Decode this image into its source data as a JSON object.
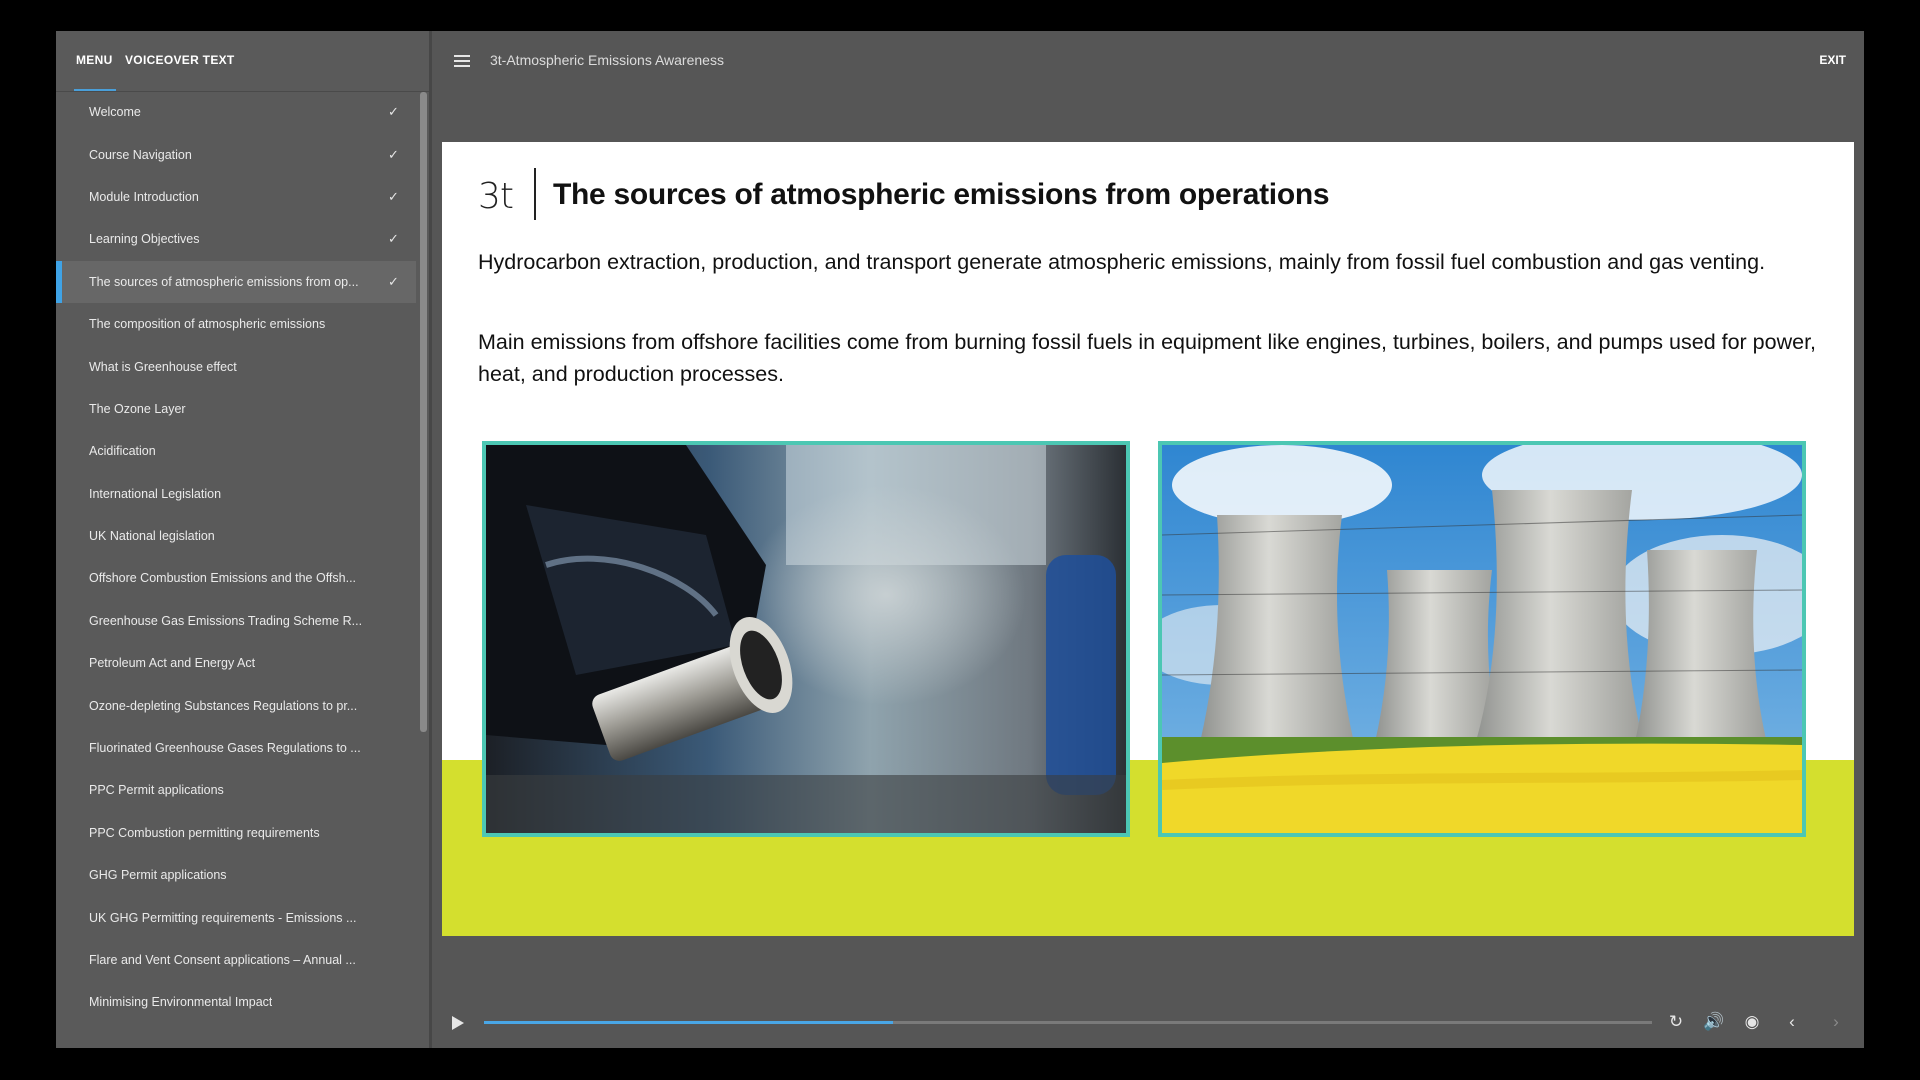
{
  "sidebar": {
    "tabs": {
      "menu": "MENU",
      "voiceover": "VOICEOVER TEXT"
    },
    "items": [
      {
        "label": "Welcome",
        "complete": true
      },
      {
        "label": "Course Navigation",
        "complete": true
      },
      {
        "label": "Module Introduction",
        "complete": true
      },
      {
        "label": "Learning Objectives",
        "complete": true
      },
      {
        "label": "The sources of atmospheric emissions from op...",
        "complete": true,
        "active": true
      },
      {
        "label": "The composition of atmospheric emissions"
      },
      {
        "label": "What is Greenhouse effect"
      },
      {
        "label": "The Ozone Layer"
      },
      {
        "label": "Acidification"
      },
      {
        "label": "International Legislation"
      },
      {
        "label": "UK National legislation"
      },
      {
        "label": "Offshore Combustion Emissions and the Offsh..."
      },
      {
        "label": "Greenhouse Gas Emissions Trading Scheme R..."
      },
      {
        "label": "Petroleum Act and Energy Act"
      },
      {
        "label": "Ozone-depleting Substances Regulations to pr..."
      },
      {
        "label": "Fluorinated Greenhouse Gases Regulations to ..."
      },
      {
        "label": "PPC Permit applications"
      },
      {
        "label": "PPC Combustion permitting requirements"
      },
      {
        "label": "GHG Permit applications"
      },
      {
        "label": "UK GHG Permitting requirements - Emissions ..."
      },
      {
        "label": "Flare and Vent Consent applications – Annual ..."
      },
      {
        "label": "Minimising Environmental Impact"
      }
    ]
  },
  "header": {
    "course_title": "3t-Atmospheric Emissions Awareness",
    "exit_label": "EXIT"
  },
  "slide": {
    "brand": "3t",
    "title": "The sources of atmospheric emissions from operations",
    "paragraph1": "Hydrocarbon extraction, production, and transport generate atmospheric emissions, mainly from fossil fuel combustion and gas venting.",
    "paragraph2": "Main emissions from offshore facilities come from burning fossil fuels in equipment like engines, turbines, boilers, and pumps used for power, heat, and production processes.",
    "images": [
      "exhaust-pipe-smoke",
      "cooling-towers-field"
    ]
  },
  "player": {
    "progress": 0.35,
    "icons": [
      "play-icon",
      "replay-icon",
      "volume-icon",
      "captions-icon",
      "previous-icon",
      "next-icon"
    ]
  },
  "colors": {
    "accent": "#3fa3e6",
    "frame": "#4cc7b3",
    "band": "#d4df2e"
  }
}
